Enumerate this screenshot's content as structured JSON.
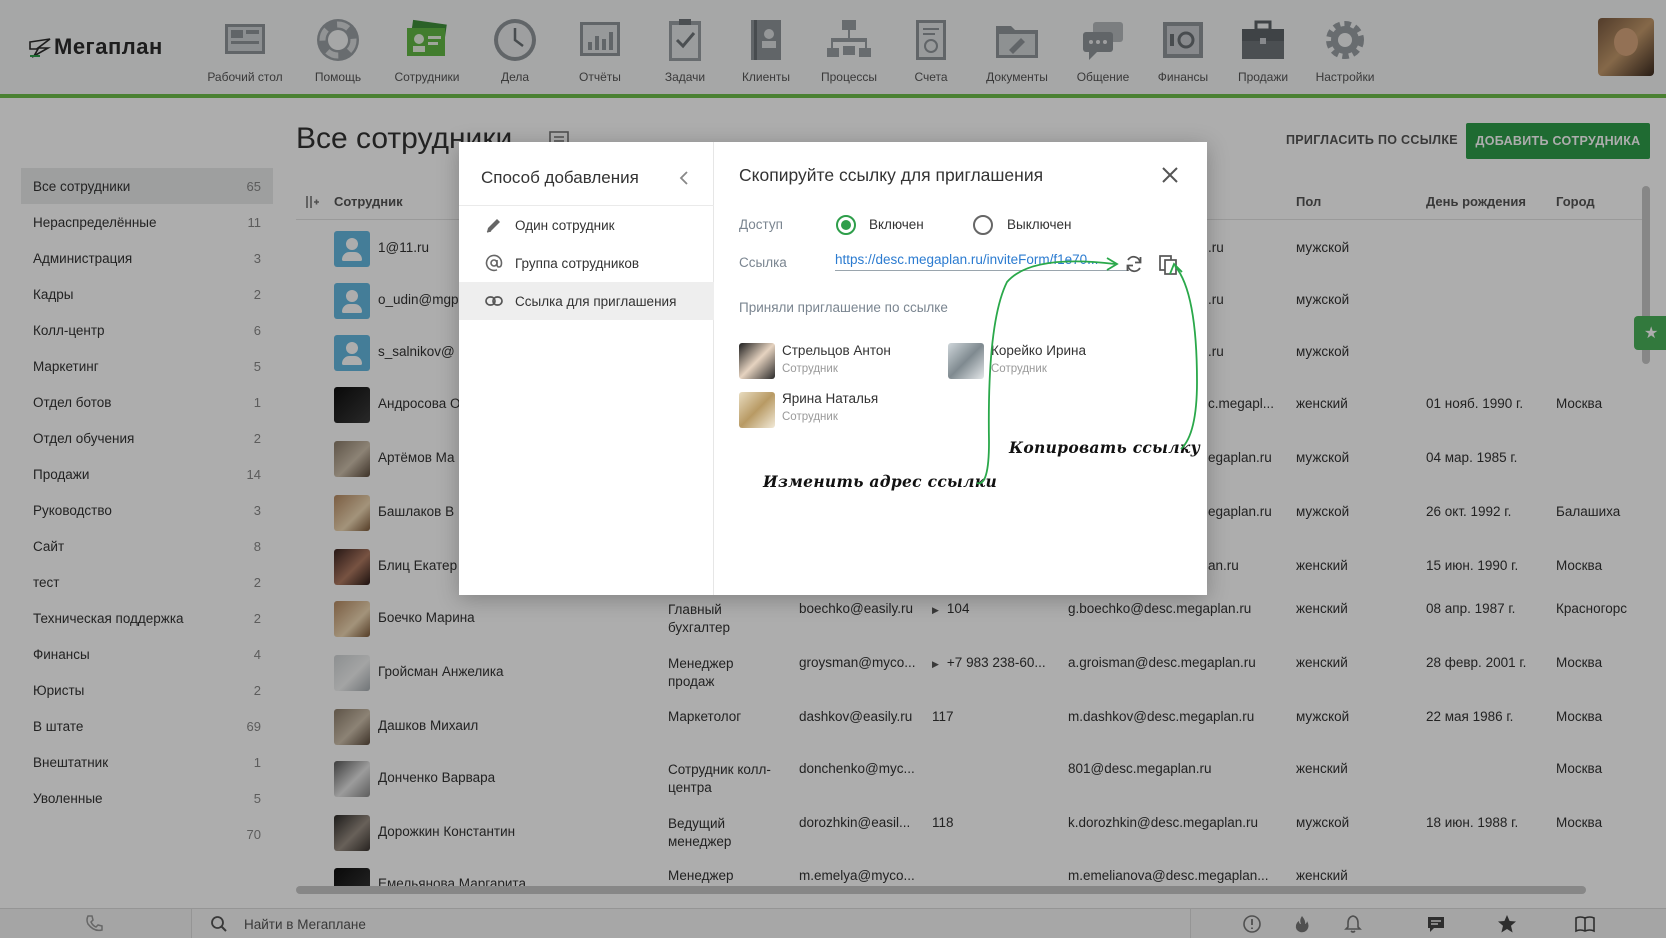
{
  "app": {
    "logo_text": "Мегаплан"
  },
  "nav": [
    {
      "label": "Рабочий стол",
      "icon": "desktop-icon"
    },
    {
      "label": "Помощь",
      "icon": "lifebuoy-icon"
    },
    {
      "label": "Сотрудники",
      "icon": "employees-icon"
    },
    {
      "label": "Дела",
      "icon": "clock-icon"
    },
    {
      "label": "Отчёты",
      "icon": "reports-icon"
    },
    {
      "label": "Задачи",
      "icon": "tasks-icon"
    },
    {
      "label": "Клиенты",
      "icon": "clients-icon"
    },
    {
      "label": "Процессы",
      "icon": "processes-icon"
    },
    {
      "label": "Счета",
      "icon": "invoices-icon"
    },
    {
      "label": "Документы",
      "icon": "documents-icon"
    },
    {
      "label": "Общение",
      "icon": "chat-icon"
    },
    {
      "label": "Финансы",
      "icon": "safe-icon"
    },
    {
      "label": "Продажи",
      "icon": "briefcase-icon"
    },
    {
      "label": "Настройки",
      "icon": "gear-icon"
    }
  ],
  "page": {
    "title": "Все сотрудники",
    "invite_link_label": "ПРИГЛАСИТЬ ПО ССЫЛКЕ",
    "add_employee_label": "ДОБАВИТЬ СОТРУДНИКА"
  },
  "sidebar": {
    "items": [
      {
        "label": "Все сотрудники",
        "count": "65"
      },
      {
        "label": "Нераспределённые",
        "count": "11"
      },
      {
        "label": "Администрация",
        "count": "3"
      },
      {
        "label": "Кадры",
        "count": "2"
      },
      {
        "label": "Колл-центр",
        "count": "6"
      },
      {
        "label": "Маркетинг",
        "count": "5"
      },
      {
        "label": "Отдел ботов",
        "count": "1"
      },
      {
        "label": "Отдел обучения",
        "count": "2"
      },
      {
        "label": "Продажи",
        "count": "14"
      },
      {
        "label": "Руководство",
        "count": "3"
      },
      {
        "label": "Сайт",
        "count": "8"
      },
      {
        "label": "тест",
        "count": "2"
      },
      {
        "label": "Техническая поддержка",
        "count": "2"
      },
      {
        "label": "Финансы",
        "count": "4"
      },
      {
        "label": "Юристы",
        "count": "2"
      },
      {
        "label": "В штате",
        "count": "69"
      },
      {
        "label": "Внештатник",
        "count": "1"
      },
      {
        "label": "Уволенные",
        "count": "5"
      },
      {
        "label": "",
        "count": "70"
      }
    ]
  },
  "table": {
    "headers": {
      "employee": "Сотрудник",
      "gender": "Пол",
      "birthday": "День рождения",
      "city": "Город"
    },
    "rows": [
      {
        "name": "1@11.ru",
        "position": "",
        "email": "",
        "phone": "",
        "login": ".ru",
        "gender": "мужской",
        "birthday": "",
        "city": ""
      },
      {
        "name": "o_udin@mgp",
        "position": "",
        "email": "",
        "phone": "",
        "login": ".ru",
        "gender": "мужской",
        "birthday": "",
        "city": ""
      },
      {
        "name": "s_salnikov@",
        "position": "",
        "email": "",
        "phone": "",
        "login": ".ru",
        "gender": "мужской",
        "birthday": "",
        "city": ""
      },
      {
        "name": "Андросова О",
        "position": "",
        "email": "",
        "phone": "",
        "login": "c.megapl...",
        "gender": "женский",
        "birthday": "01 нояб. 1990 г.",
        "city": "Москва"
      },
      {
        "name": "Артёмов Ма",
        "position": "",
        "email": "",
        "phone": "",
        "login": "egaplan.ru",
        "gender": "мужской",
        "birthday": "04 мар. 1985 г.",
        "city": ""
      },
      {
        "name": "Башлаков В",
        "position": "",
        "email": "",
        "phone": "",
        "login": "egaplan.ru",
        "gender": "мужской",
        "birthday": "26 окт. 1992 г.",
        "city": "Балашиха"
      },
      {
        "name": "Блиц Екатер",
        "position": "",
        "email": "",
        "phone": "",
        "login": "an.ru",
        "gender": "женский",
        "birthday": "15 июн. 1990 г.",
        "city": "Москва"
      },
      {
        "name": "Боечко Марина",
        "position": "Главный бухгалтер",
        "email": "boechko@easily.ru",
        "phone": "104",
        "login": "g.boechko@desc.megaplan.ru",
        "gender": "женский",
        "birthday": "08 апр. 1987 г.",
        "city": "Красногорс"
      },
      {
        "name": "Гройсман Анжелика",
        "position": "Менеджер продаж",
        "email": "groysman@myco...",
        "phone": "+7 983 238-60...",
        "login": "a.groisman@desc.megaplan.ru",
        "gender": "женский",
        "birthday": "28 февр. 2001 г.",
        "city": "Москва"
      },
      {
        "name": "Дашков Михаил",
        "position": "Маркетолог",
        "email": "dashkov@easily.ru",
        "phone": "117",
        "login": "m.dashkov@desc.megaplan.ru",
        "gender": "мужской",
        "birthday": "22 мая 1986 г.",
        "city": "Москва"
      },
      {
        "name": "Донченко Варвара",
        "position": "Сотрудник колл-центра",
        "email": "donchenko@myc...",
        "phone": "",
        "login": "801@desc.megaplan.ru",
        "gender": "женский",
        "birthday": "",
        "city": "Москва"
      },
      {
        "name": "Дорожкин Константин",
        "position": "Ведущий менеджер",
        "email": "dorozhkin@easil...",
        "phone": "118",
        "login": "k.dorozhkin@desc.megaplan.ru",
        "gender": "мужской",
        "birthday": "18 июн. 1988 г.",
        "city": "Москва"
      },
      {
        "name": "Емельянова Маргарита",
        "position": "Менеджер",
        "email": "m.emelya@myco...",
        "phone": "",
        "login": "m.emelianova@desc.megaplan...",
        "gender": "женский",
        "birthday": "",
        "city": ""
      }
    ]
  },
  "bottombar": {
    "search_placeholder": "Найти в Мегаплане"
  },
  "modal": {
    "left": {
      "title": "Способ добавления",
      "items": [
        {
          "label": "Один сотрудник",
          "icon": "pencil-icon"
        },
        {
          "label": "Группа сотрудников",
          "icon": "at-icon"
        },
        {
          "label": "Ссылка для приглашения",
          "icon": "link-icon"
        }
      ]
    },
    "right": {
      "title": "Скопируйте ссылку для приглашения",
      "access_label": "Доступ",
      "access_on": "Включен",
      "access_off": "Выключен",
      "access_value": "Включен",
      "link_label": "Ссылка",
      "link_url": "https://desc.megaplan.ru/inviteForm/f1e70...",
      "accepted_title": "Приняли приглашение по ссылке",
      "accepted": [
        {
          "name": "Стрельцов Антон",
          "role": "Сотрудник"
        },
        {
          "name": "Корейко Ирина",
          "role": "Сотрудник"
        },
        {
          "name": "Ярина Наталья",
          "role": "Сотрудник"
        }
      ],
      "annotation_copy": "Копировать ссылку",
      "annotation_change": "Изменить адрес ссылки"
    }
  },
  "colors": {
    "accent_green": "#2e9e4a",
    "nav_underline": "#6dbf4b",
    "link_blue": "#2b7bd0",
    "fav_tab": "#4bb35a"
  }
}
